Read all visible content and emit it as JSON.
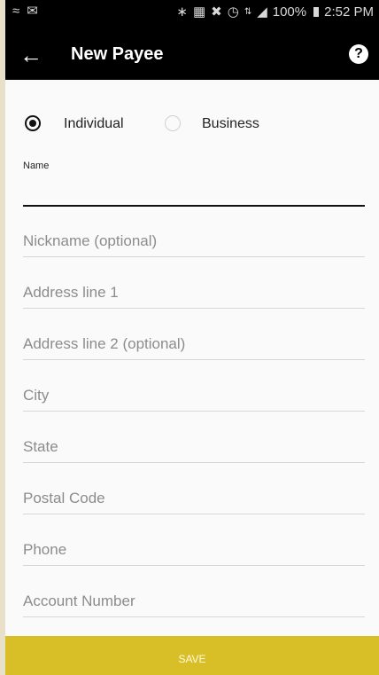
{
  "status_bar": {
    "left_icons": [
      "wifi-call-icon",
      "mail-icon"
    ],
    "right_icons": [
      "bluetooth-icon",
      "nfc-icon",
      "mute-icon",
      "alarm-icon",
      "lte-icon",
      "signal-icon"
    ],
    "battery": "100%",
    "time": "2:52 PM"
  },
  "app_bar": {
    "title": "New Payee",
    "back_icon": "back-arrow-icon",
    "help_icon": "help-icon"
  },
  "payee_type": {
    "options": [
      {
        "label": "Individual",
        "selected": true
      },
      {
        "label": "Business",
        "selected": false
      }
    ]
  },
  "form": {
    "name_label": "Name",
    "name_value": "",
    "fields": [
      {
        "placeholder": "Nickname (optional)",
        "value": ""
      },
      {
        "placeholder": "Address line 1",
        "value": ""
      },
      {
        "placeholder": "Address line 2 (optional)",
        "value": ""
      },
      {
        "placeholder": "City",
        "value": ""
      },
      {
        "placeholder": "State",
        "value": ""
      },
      {
        "placeholder": "Postal Code",
        "value": ""
      },
      {
        "placeholder": "Phone",
        "value": ""
      },
      {
        "placeholder": "Account Number",
        "value": ""
      }
    ]
  },
  "save_label": "SAVE",
  "colors": {
    "app_bar": "#000000",
    "save_button": "#d8bf27",
    "background": "#fafafa"
  }
}
